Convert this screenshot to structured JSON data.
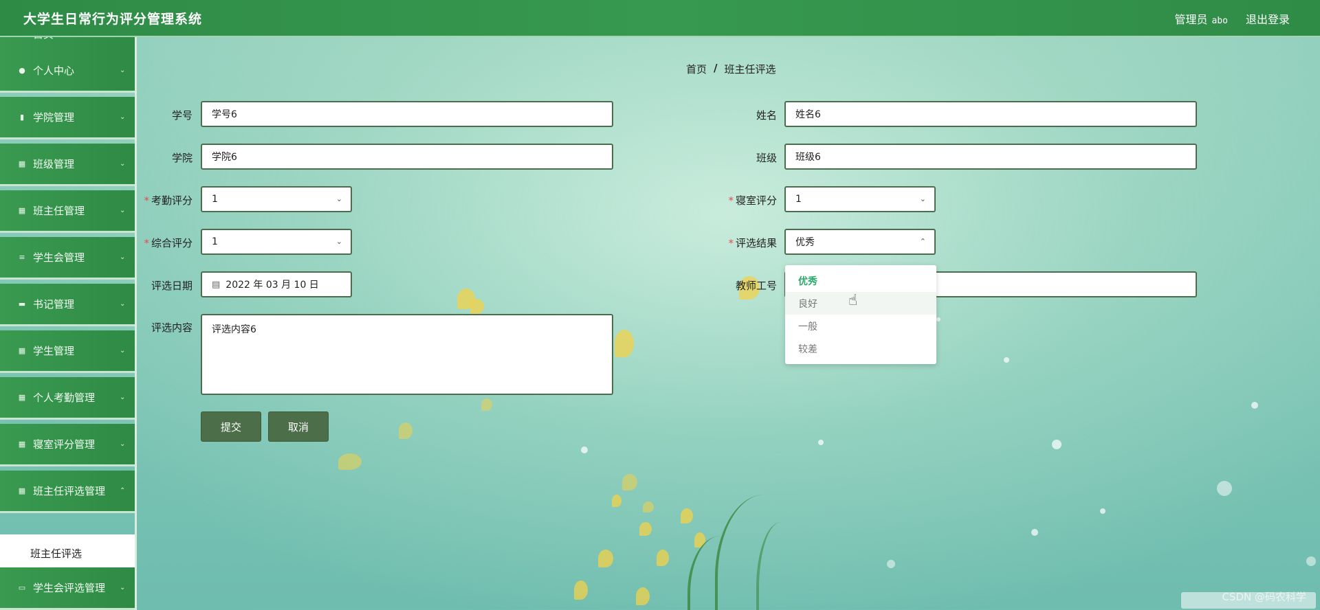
{
  "header": {
    "title": "大学生日常行为评分管理系统",
    "user_role": "管理员",
    "user_name": "abo",
    "logout": "退出登录"
  },
  "sidebar": {
    "items": [
      {
        "label": "首页",
        "icon": "home-icon"
      },
      {
        "label": "个人中心",
        "icon": "user-icon"
      },
      {
        "label": "学院管理",
        "icon": "bar-chart-icon"
      },
      {
        "label": "班级管理",
        "icon": "grid-icon"
      },
      {
        "label": "班主任管理",
        "icon": "grid-icon"
      },
      {
        "label": "学生会管理",
        "icon": "list-icon"
      },
      {
        "label": "书记管理",
        "icon": "briefcase-icon"
      },
      {
        "label": "学生管理",
        "icon": "grid-icon"
      },
      {
        "label": "个人考勤管理",
        "icon": "grid-icon"
      },
      {
        "label": "寝室评分管理",
        "icon": "grid-icon"
      },
      {
        "label": "班主任评选管理",
        "icon": "grid-icon"
      },
      {
        "label": "学生会评选管理",
        "icon": "ticket-icon"
      }
    ],
    "active_sub": "班主任评选"
  },
  "breadcrumb": {
    "home": "首页",
    "separator": "/",
    "current": "班主任评选"
  },
  "form": {
    "student_no": {
      "label": "学号",
      "value": "学号6"
    },
    "name": {
      "label": "姓名",
      "value": "姓名6"
    },
    "college": {
      "label": "学院",
      "value": "学院6"
    },
    "class": {
      "label": "班级",
      "value": "班级6"
    },
    "attendance_score": {
      "label": "考勤评分",
      "value": "1"
    },
    "dorm_score": {
      "label": "寝室评分",
      "value": "1"
    },
    "overall_score": {
      "label": "综合评分",
      "value": "1"
    },
    "result": {
      "label": "评选结果",
      "value": "优秀"
    },
    "date": {
      "label": "评选日期",
      "value": "2022 年 03 月 10 日"
    },
    "teacher_no": {
      "label": "教师工号",
      "value": ""
    },
    "content": {
      "label": "评选内容",
      "value": "评选内容6"
    },
    "required_mark": "*",
    "submit": "提交",
    "cancel": "取消"
  },
  "dropdown": {
    "options": [
      "优秀",
      "良好",
      "一般",
      "较差"
    ],
    "selected_index": 0,
    "hover_index": 1
  },
  "watermark": "CSDN @码农科学"
}
